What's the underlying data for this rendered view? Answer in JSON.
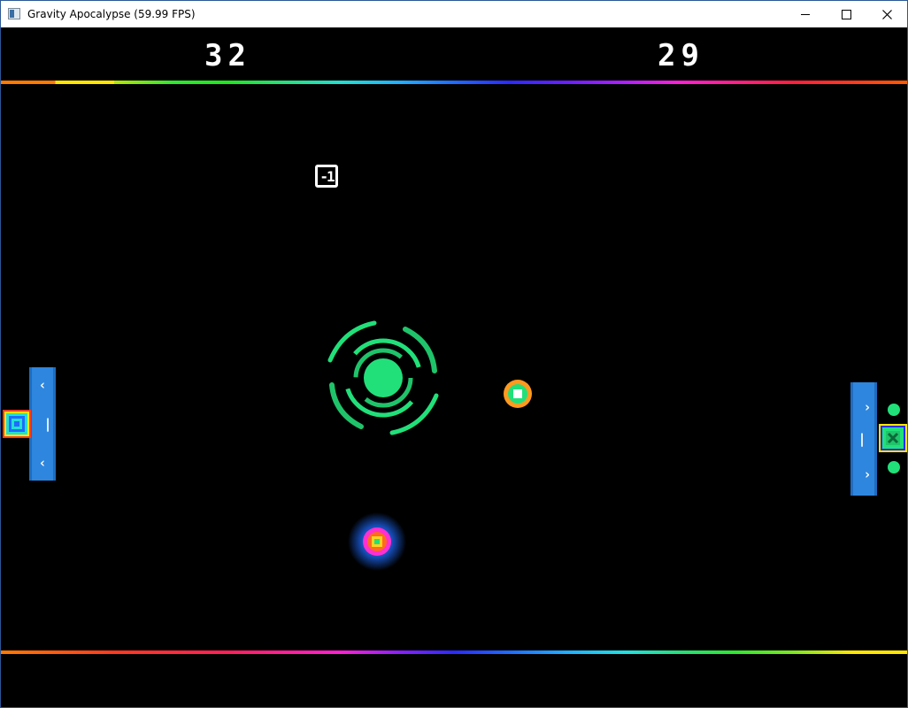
{
  "window": {
    "title": "Gravity Apocalypse (59.99 FPS)",
    "minimize_icon": "minimize-icon",
    "maximize_icon": "maximize-icon",
    "close_icon": "close-icon"
  },
  "game": {
    "background_color": "#000000",
    "scores": {
      "left": "32",
      "right": "29"
    },
    "powerup": {
      "label": "-1",
      "icon": "minus-one-powerup-icon"
    },
    "paddles": {
      "left": {
        "color": "#2e86de",
        "marks": [
          "‹",
          "|",
          "‹"
        ]
      },
      "right": {
        "color": "#2e86de",
        "marks": [
          "›",
          "|",
          "›"
        ]
      }
    },
    "colors": {
      "vortex": "#21e07a",
      "orb_core": "#ffd21f",
      "orb_glow": "#1f6bff",
      "ball": "#ff9a1f"
    }
  }
}
